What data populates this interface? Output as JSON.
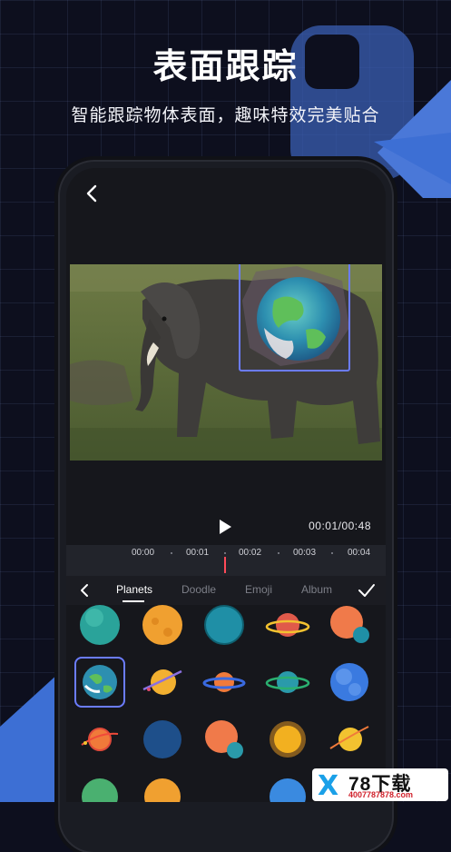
{
  "promo": {
    "headline": "表面跟踪",
    "subline": "智能跟踪物体表面，趣味特效完美贴合"
  },
  "player": {
    "timecode": "00:01/00:48",
    "ticks": [
      "00:00",
      "00:01",
      "00:02",
      "00:03",
      "00:04"
    ]
  },
  "sticker_panel": {
    "tabs": [
      "Planets",
      "Doodle",
      "Emoji",
      "Album"
    ],
    "active_tab": "Planets",
    "selected_sticker": "earth",
    "rows": [
      [
        "teal-planet",
        "orange-planet",
        "blue-planet",
        "ringed-red-planet",
        "orange-moon-planet"
      ],
      [
        "earth",
        "ringed-yellow-planet",
        "ringed-orange-planet",
        "ringed-teal-planet",
        "blue-cloudy-planet"
      ],
      [
        "red-orbit-planet",
        "dark-blue-planet",
        "orange-teal-moon-planet",
        "sun",
        "ringed-gold-planet"
      ]
    ]
  },
  "watermark": {
    "mark": "X",
    "brand": "78下载",
    "phone": "4007787878.com"
  },
  "colors": {
    "accent": "#6b7cff",
    "playhead": "#ff4a58",
    "deco_blue": "#3d6fd4"
  }
}
